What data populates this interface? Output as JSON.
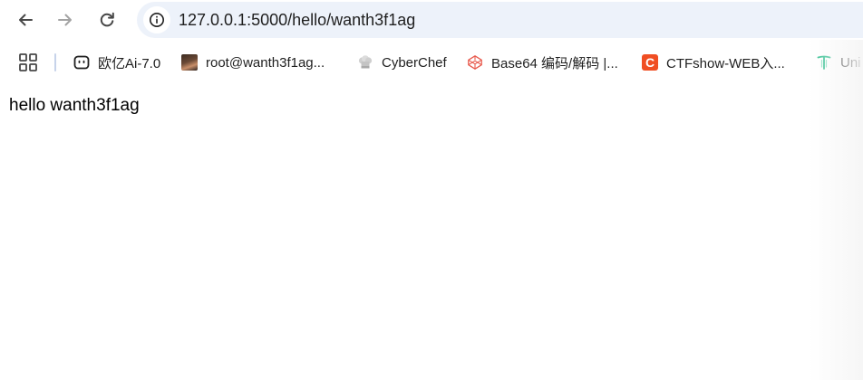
{
  "toolbar": {
    "url": "127.0.0.1:5000/hello/wanth3f1ag",
    "back_icon": "arrow-left-icon",
    "forward_icon": "arrow-right-icon",
    "reload_icon": "reload-icon",
    "site_info_icon": "info-icon"
  },
  "bookmarks": {
    "apps_icon": "apps-grid-icon",
    "items": [
      {
        "label": "欧亿Ai-7.0",
        "icon": "robot-face-icon"
      },
      {
        "label": "root@wanth3f1ag...",
        "icon": "avatar-icon"
      },
      {
        "label": "CyberChef",
        "icon": "chef-hat-icon"
      },
      {
        "label": "Base64 编码/解码 |...",
        "icon": "codepen-cube-icon"
      },
      {
        "label": "CTFshow-WEB入...",
        "icon": "ctfshow-c-icon",
        "icon_text": "C"
      },
      {
        "label": "Uni",
        "icon": "t-logo-icon"
      }
    ]
  },
  "page": {
    "body_text": "hello wanth3f1ag"
  },
  "colors": {
    "omnibox_bg": "#edf2fa",
    "ctfshow_brand": "#f04e23",
    "codepen_icon": "#e8584b",
    "t_logo": "#2fbf8f"
  }
}
